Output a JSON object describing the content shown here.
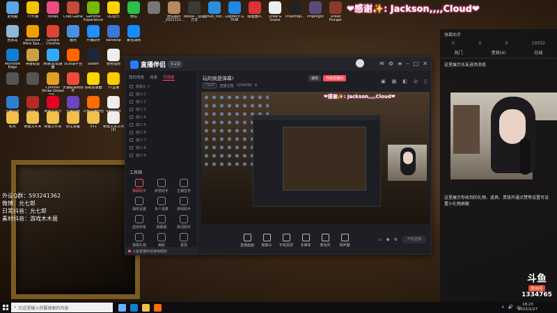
{
  "desktop": {
    "icons": [
      {
        "label": "此电脑",
        "color": "#5aa7e8"
      },
      {
        "label": "YY开播",
        "color": "#f5c400"
      },
      {
        "label": "itunes",
        "color": "#e94d84"
      },
      {
        "label": "Crab Game",
        "color": "#c44a3a"
      },
      {
        "label": "GeForce Experience",
        "color": "#76b900"
      },
      {
        "label": "QQ音乐",
        "color": "#ffd400"
      },
      {
        "label": "微信",
        "color": "#2cc04a"
      },
      {
        "label": "",
        "color": "#777777"
      },
      {
        "label": "微信图片_2021111...",
        "color": "#b58a5c"
      },
      {
        "label": "obs64 - 快捷方式",
        "color": "#3a3a3a"
      },
      {
        "label": "lghub_inst...",
        "color": "#2a8fe0"
      },
      {
        "label": "Logitech G HUB",
        "color": "#1e88e5"
      },
      {
        "label": "曝盘器PC",
        "color": "#d33"
      },
      {
        "label": "Draw & Guess",
        "color": "#eee"
      },
      {
        "label": "Phasmop...",
        "color": "#222"
      },
      {
        "label": "Propnight",
        "color": "#5a4a7a"
      },
      {
        "label": "Dread Hunger",
        "color": "#8b3a2a"
      },
      {
        "label": "回收站",
        "color": "#8fb7d8"
      },
      {
        "label": "Rockstar Wine Spa...",
        "color": "#f0a000"
      },
      {
        "label": "Google Chrome",
        "color": "#db4437"
      },
      {
        "label": "画吧",
        "color": "#4a90e2"
      },
      {
        "label": "开播助手",
        "color": "#1e90ff"
      },
      {
        "label": "Bandizip",
        "color": "#3c78d8"
      },
      {
        "label": "暴雪战网",
        "color": "#148eff"
      },
      {
        "label": "Microsoft Edge",
        "color": "#0f7fd4"
      },
      {
        "label": "英雄联盟",
        "color": "#c9a243"
      },
      {
        "label": "网易UU加速器",
        "color": "#33aaff"
      },
      {
        "label": "5E对战平台",
        "color": "#ff6600"
      },
      {
        "label": "Steam",
        "color": "#1b2838"
      },
      {
        "label": "使用指南",
        "color": "#eeeeee"
      },
      {
        "label": "DEVOUR",
        "color": "#3a1e10"
      },
      {
        "label": "",
        "color": "#555"
      },
      {
        "label": "",
        "color": "#555"
      },
      {
        "label": "Counter-Strike Global Off...",
        "color": "#e0a020"
      },
      {
        "label": "天猫联录制软件",
        "color": "#f04a3c"
      },
      {
        "label": "谷歌加速器",
        "color": "#ffd400"
      },
      {
        "label": "YY直播",
        "color": "#ffcc00"
      },
      {
        "label": "Escape Simulator",
        "color": "#c55a2a"
      },
      {
        "label": "小猫元宇",
        "color": "#2d7fd3"
      },
      {
        "label": "Dota 2",
        "color": "#b32b24"
      },
      {
        "label": "网易云音乐",
        "color": "#e60026"
      },
      {
        "label": "无畏动画",
        "color": "#6a45c0"
      },
      {
        "label": "斗鱼直播伴侣",
        "color": "#ff6b00"
      },
      {
        "label": "xwenctp",
        "color": "#eee"
      },
      {
        "label": "zhaopian",
        "color": "#f0c04a"
      },
      {
        "label": "昵化",
        "color": "#f0c04a"
      },
      {
        "label": "新建文件夹",
        "color": "#f0c04a"
      },
      {
        "label": "新建文件夹",
        "color": "#f0c04a"
      },
      {
        "label": "原生设备",
        "color": "#f0c04a"
      },
      {
        "label": "551",
        "color": "#f0c04a"
      },
      {
        "label": "新建文本文档 (3)",
        "color": "#eeeeee"
      }
    ]
  },
  "overlay": {
    "banner": "❤感谢✨: Jackson,,,,Cloud❤",
    "info_lines": [
      "外设Q群：593241362",
      "微博：允七郎",
      "日常抖音：允七郎",
      "素材抖音：游戏木木菌"
    ]
  },
  "right_panel": {
    "title": "弹幕助手",
    "stats": [
      "0",
      "0",
      "0",
      "19332"
    ],
    "tabs": [
      "热门",
      "贵宾(4)",
      "在线"
    ],
    "msg_top": "这里展示水友进场消息",
    "msg_bottom": "这里展示你收到的礼物、道具、贵族开通点赞等设置可设置小礼物屏蔽"
  },
  "douyu": {
    "mark": "斗鱼",
    "room_label": "房间号",
    "room_number": "1334765"
  },
  "app": {
    "name": "直播伴侣",
    "version": "测试版",
    "room_title": "玩的就是弹幕!",
    "edit_label": "编辑",
    "open_label": "开启直播间",
    "room_tags": [
      "CSGO",
      "直播主题",
      "1334765",
      "0"
    ],
    "scene_tabs": [
      "我的场景",
      "场景",
      "可场景"
    ],
    "scenes": [
      "摄像头 1",
      "窗口 1",
      "窗口 2",
      "窗口 3",
      "窗口 4",
      "窗口 5",
      "窗口 6",
      "窗口 7",
      "窗口 8",
      "窗口 9"
    ],
    "tools_title": "工具箱",
    "tools": [
      "弹幕助手",
      "房管助手",
      "主播任务",
      "抽奖设置",
      "多人连麦",
      "游戏助手",
      "虚拟形象",
      "弹幕姬",
      "歌词助手",
      "弹幕礼物",
      "美颜",
      "录屏"
    ],
    "warning": "斗鱼直播伴侣使用帮助",
    "bottom_tools": [
      "直播画面",
      "摄像头",
      "手机投屏",
      "多媒体",
      "麦克风",
      "扬声器"
    ],
    "start_label": "开始直播"
  },
  "taskbar": {
    "search_placeholder": "在这里输入你要搜索的内容",
    "tray": [
      "∧",
      "🔊",
      "中",
      "⊕"
    ],
    "time": "18:23",
    "date": "2022/1/27"
  }
}
